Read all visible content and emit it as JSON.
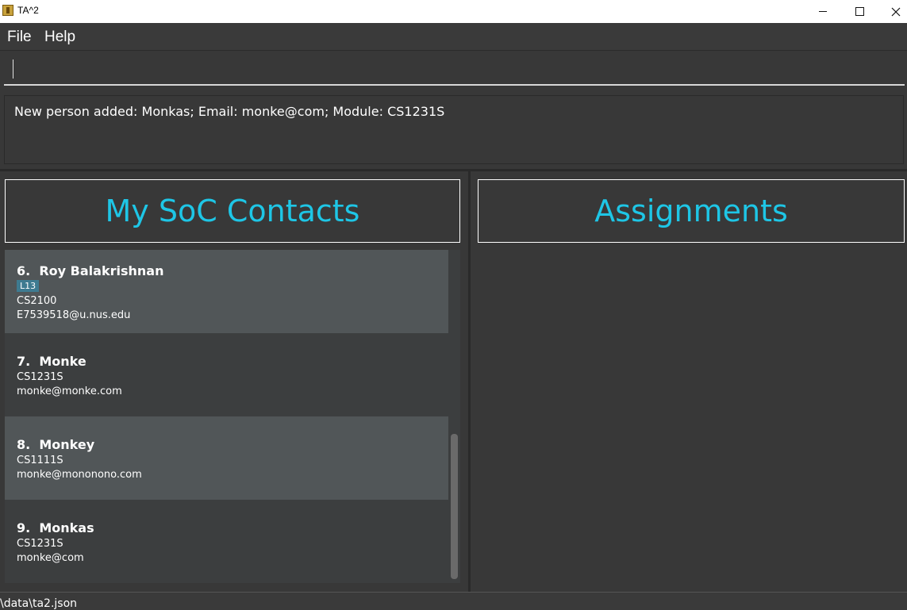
{
  "window": {
    "title": "TA^2",
    "icon": "app-icon",
    "controls": [
      "minimize-icon",
      "maximize-icon",
      "close-icon"
    ]
  },
  "menu": {
    "file": "File",
    "help": "Help"
  },
  "command": {
    "value": ""
  },
  "result": {
    "message": "New person added: Monkas; Email: monke@com; Module: CS1231S"
  },
  "contacts": {
    "title": "My SoC Contacts",
    "items": [
      {
        "index": "6.",
        "name": "Roy Balakrishnan",
        "tag": "L13",
        "module": "CS2100",
        "email": "E7539518@u.nus.edu"
      },
      {
        "index": "7.",
        "name": "Monke",
        "module": "CS1231S",
        "email": "monke@monke.com"
      },
      {
        "index": "8.",
        "name": "Monkey",
        "module": "CS1111S",
        "email": "monke@mononono.com"
      },
      {
        "index": "9.",
        "name": "Monkas",
        "module": "CS1231S",
        "email": "monke@com"
      }
    ]
  },
  "assignments": {
    "title": "Assignments"
  },
  "status": {
    "path": "\\data\\ta2.json"
  },
  "colors": {
    "accent": "#1ec6e6",
    "background": "#383838",
    "card_light": "#515658",
    "card_dark": "#3c3e3f",
    "tag": "#3e7b91"
  }
}
